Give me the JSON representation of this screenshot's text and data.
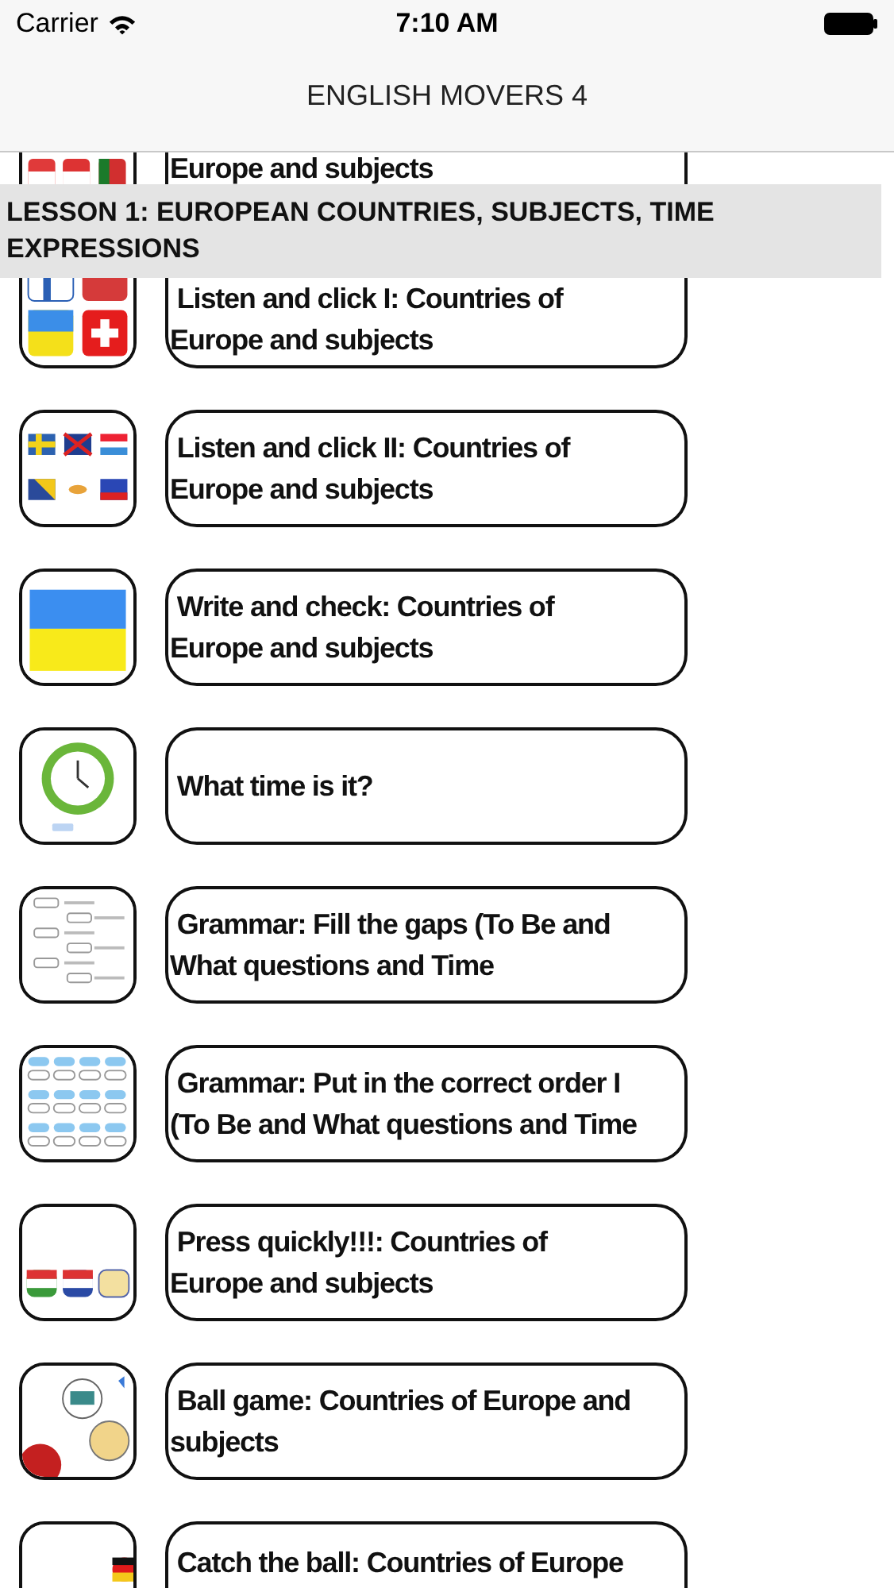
{
  "status_bar": {
    "carrier": "Carrier",
    "time": "7:10 AM"
  },
  "nav_bar": {
    "title": "ENGLISH MOVERS 4"
  },
  "section": {
    "title": "LESSON 1: EUROPEAN COUNTRIES, SUBJECTS, TIME EXPRESSIONS"
  },
  "activities": [
    {
      "title": "Europe and subjects"
    },
    {
      "title": " Listen and click I: Countries of\nEurope and subjects"
    },
    {
      "title": " Listen and click II: Countries of\nEurope and subjects"
    },
    {
      "title": " Write and check: Countries of\nEurope and subjects"
    },
    {
      "title": " What time is it?"
    },
    {
      "title": " Grammar: Fill the gaps (To Be and\nWhat questions and Time"
    },
    {
      "title": " Grammar: Put in the correct order I\n(To Be and What questions and Time"
    },
    {
      "title": " Press quickly!!!: Countries of\nEurope and subjects"
    },
    {
      "title": " Ball game: Countries of Europe and\nsubjects"
    },
    {
      "title": " Catch the ball: Countries of Europe"
    }
  ]
}
